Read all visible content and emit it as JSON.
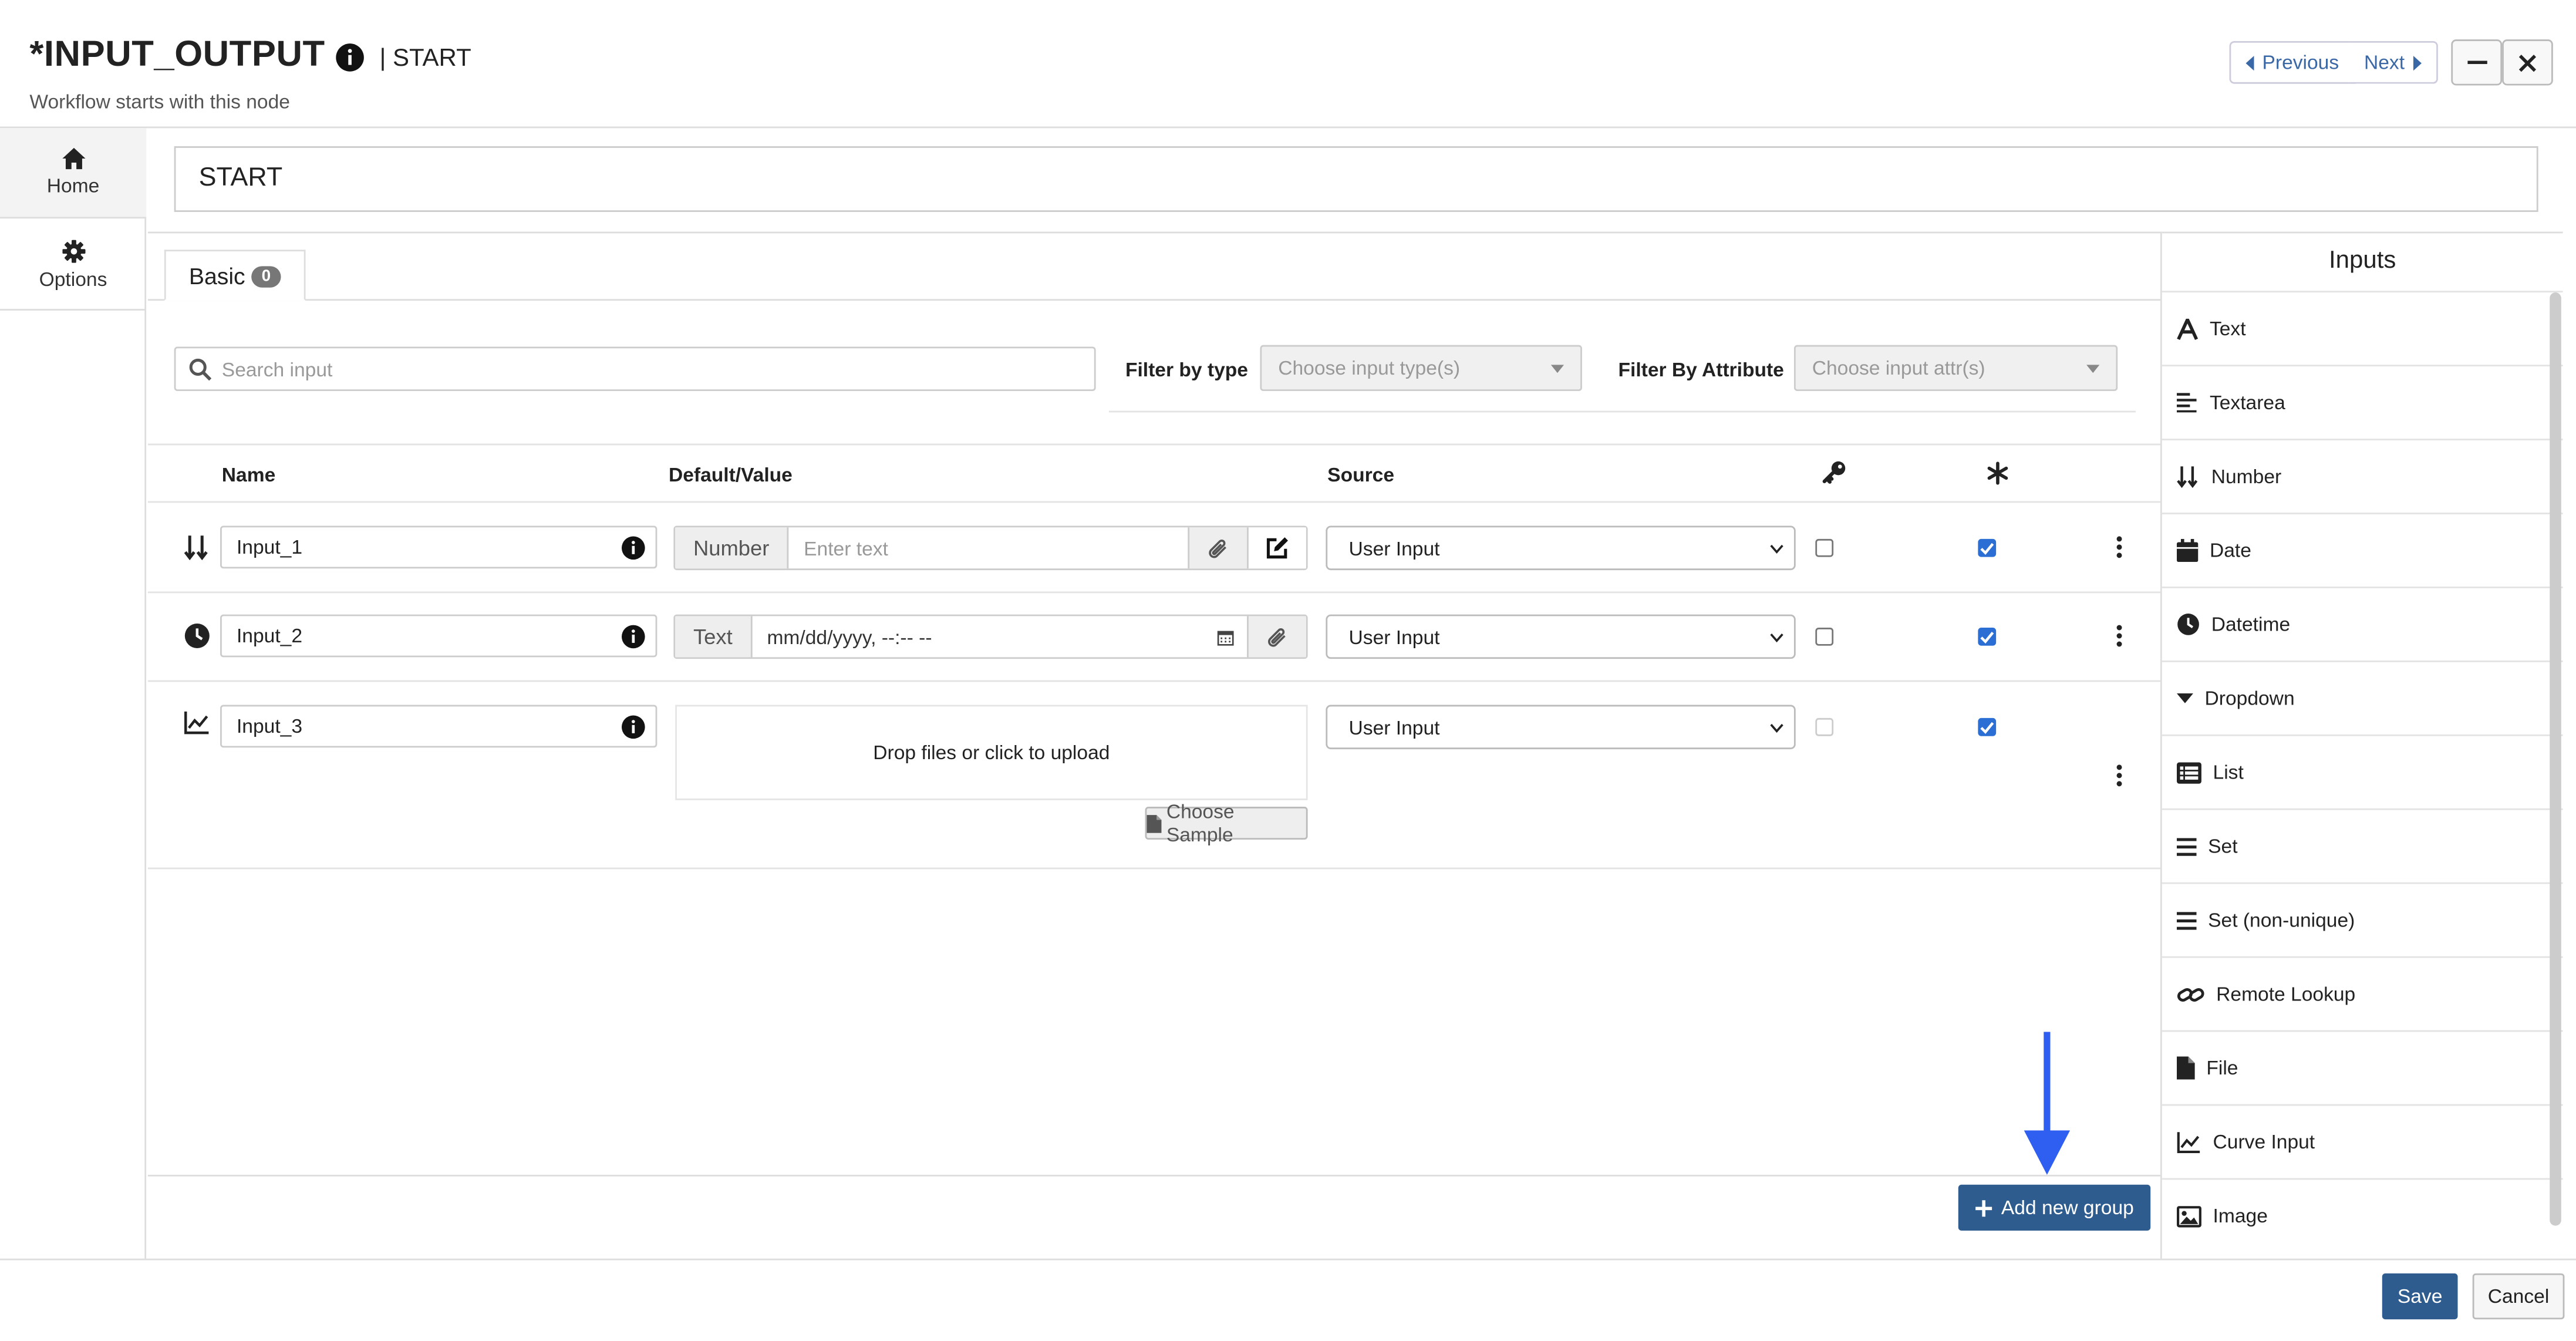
{
  "header": {
    "title": "*INPUT_OUTPUT",
    "subtitle": "| START",
    "description": "Workflow starts with this node",
    "previous_label": "Previous",
    "next_label": "Next"
  },
  "leftnav": {
    "home_label": "Home",
    "options_label": "Options"
  },
  "node_name": "START",
  "tabs": [
    {
      "label": "Basic",
      "count": "0"
    }
  ],
  "search": {
    "placeholder": "Search input"
  },
  "filters": {
    "type_label": "Filter by type",
    "type_placeholder": "Choose input type(s)",
    "attr_label": "Filter By Attribute",
    "attr_placeholder": "Choose input attr(s)"
  },
  "table": {
    "headers": {
      "name": "Name",
      "default": "Default/Value",
      "source": "Source",
      "key_icon": "key-icon",
      "required_icon": "asterisk-icon"
    },
    "rows": [
      {
        "icon": "sort-numeric-icon",
        "name": "Input_1",
        "type": "Number",
        "value_placeholder": "Enter text",
        "source": "User Input",
        "key": false,
        "required": true
      },
      {
        "icon": "clock-icon",
        "name": "Input_2",
        "type": "Text",
        "value_placeholder": "mm/dd/yyyy, --:-- --",
        "source": "User Input",
        "key": false,
        "required": true
      },
      {
        "icon": "line-chart-icon",
        "name": "Input_3",
        "dropzone_text": "Drop files or click to upload",
        "choose_sample_label": "Choose Sample",
        "source": "User Input",
        "key": false,
        "key_disabled": true,
        "required": true
      }
    ]
  },
  "add_group_label": "Add new group",
  "inputs_panel": {
    "title": "Inputs",
    "items": [
      {
        "label": "Text",
        "icon": "font-icon"
      },
      {
        "label": "Textarea",
        "icon": "align-left-icon"
      },
      {
        "label": "Number",
        "icon": "sort-numeric-icon"
      },
      {
        "label": "Date",
        "icon": "calendar-icon"
      },
      {
        "label": "Datetime",
        "icon": "clock-icon"
      },
      {
        "label": "Dropdown",
        "icon": "caret-down-icon"
      },
      {
        "label": "List",
        "icon": "list-icon"
      },
      {
        "label": "Set",
        "icon": "bars-icon"
      },
      {
        "label": "Set (non-unique)",
        "icon": "bars-icon"
      },
      {
        "label": "Remote Lookup",
        "icon": "link-icon"
      },
      {
        "label": "File",
        "icon": "file-icon"
      },
      {
        "label": "Curve Input",
        "icon": "line-chart-icon"
      },
      {
        "label": "Image",
        "icon": "image-icon"
      }
    ]
  },
  "footer": {
    "save_label": "Save",
    "cancel_label": "Cancel"
  },
  "colors": {
    "primary": "#2f5c8f",
    "link": "#3a67a6",
    "checkbox": "#2c6fd4",
    "annotation_arrow": "#2f5ff0"
  }
}
